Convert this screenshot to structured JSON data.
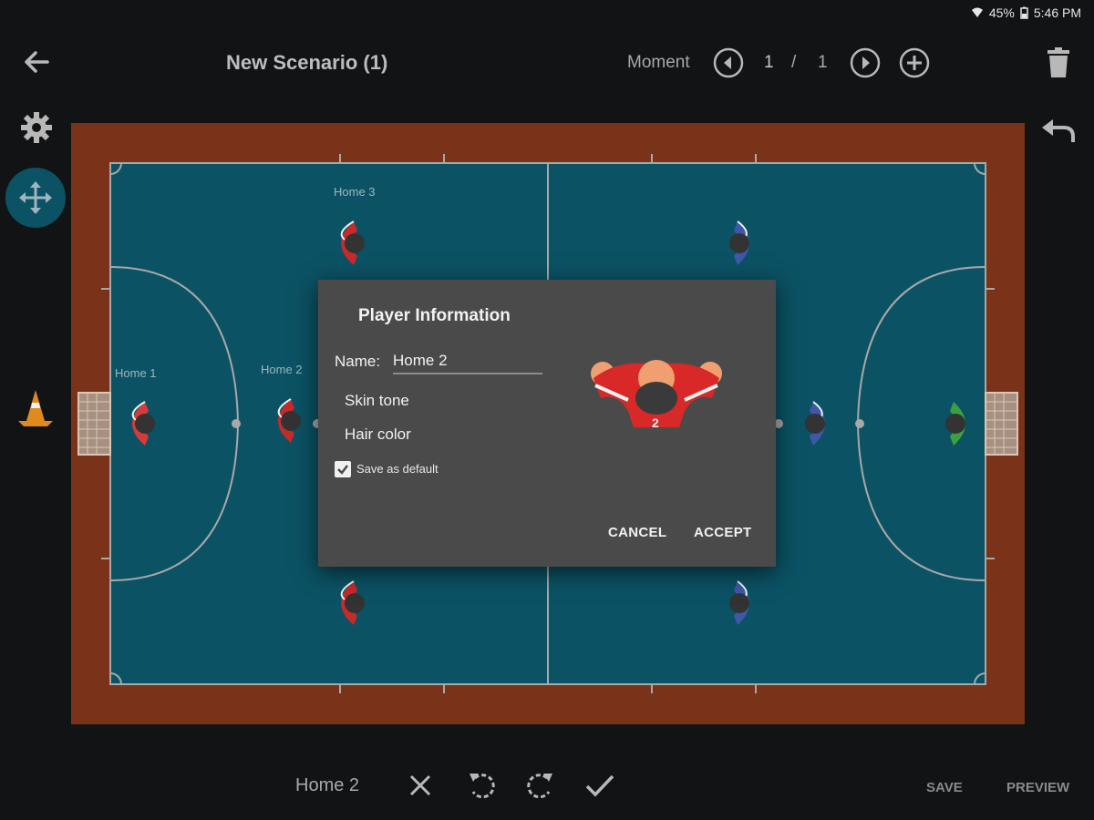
{
  "status_bar": {
    "battery": "45%",
    "time": "5:46 PM"
  },
  "header": {
    "title": "New Scenario (1)",
    "moment_label": "Moment",
    "moment_current": "1",
    "moment_separator": "/",
    "moment_total": "1"
  },
  "court": {
    "colors": {
      "floor": "#0b5264",
      "border": "#7a3318",
      "lines": "#a8a8a8"
    },
    "players": {
      "home1": "Home 1",
      "home2": "Home 2",
      "home3": "Home 3"
    }
  },
  "dialog": {
    "title": "Player Information",
    "name_label": "Name:",
    "name_value": "Home 2",
    "skin_tone_label": "Skin tone",
    "hair_color_label": "Hair color",
    "save_default_label": "Save as default",
    "save_default_checked": true,
    "cancel_label": "CANCEL",
    "accept_label": "ACCEPT",
    "avatar_number": "2"
  },
  "bottom_bar": {
    "selected_player": "Home 2",
    "save_label": "SAVE",
    "preview_label": "PREVIEW"
  }
}
